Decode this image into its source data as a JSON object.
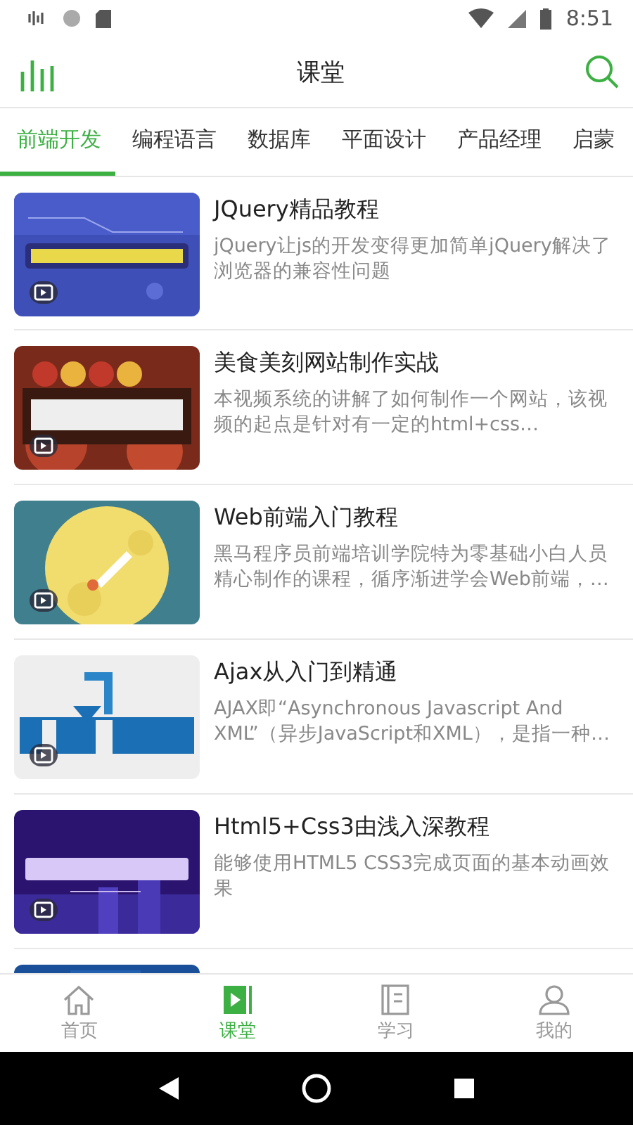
{
  "status_bar": {
    "time": "8:51"
  },
  "app_bar": {
    "title": "课堂"
  },
  "tabs": [
    {
      "label": "前端开发",
      "selected": true
    },
    {
      "label": "编程语言",
      "selected": false
    },
    {
      "label": "数据库",
      "selected": false
    },
    {
      "label": "平面设计",
      "selected": false
    },
    {
      "label": "产品经理",
      "selected": false
    },
    {
      "label": "启蒙",
      "selected": false
    }
  ],
  "courses": [
    {
      "title": "JQuery精品教程",
      "description": "jQuery让js的开发变得更加简单jQuery解决了浏览器的兼容性问题"
    },
    {
      "title": "美食美刻网站制作实战",
      "description": "本视频系统的讲解了如何制作一个网站，该视频的起点是针对有一定的html+css…"
    },
    {
      "title": "Web前端入门教程",
      "description": "黑马程序员前端培训学院特为零基础小白人员精心制作的课程，循序渐进学会Web前端，…"
    },
    {
      "title": "Ajax从入门到精通",
      "description": "AJAX即“Asynchronous Javascript And\nXML”（异步JavaScript和XML），是指一种…"
    },
    {
      "title": "Html5+Css3由浅入深教程",
      "description": "能够使用HTML5 CSS3完成页面的基本动画效果"
    }
  ],
  "bottom_nav": [
    {
      "label": "首页",
      "selected": false
    },
    {
      "label": "课堂",
      "selected": true
    },
    {
      "label": "学习",
      "selected": false
    },
    {
      "label": "我的",
      "selected": false
    }
  ]
}
